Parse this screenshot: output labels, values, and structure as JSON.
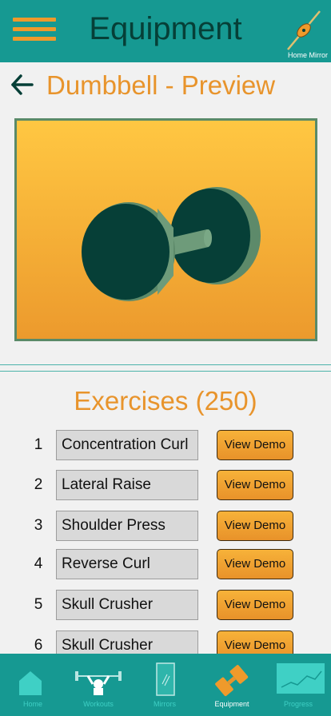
{
  "header": {
    "title": "Equipment",
    "menu_icon": "hamburger-menu-icon",
    "mirror_icon": "home-mirror-icon",
    "mirror_label": "Home Mirror"
  },
  "page": {
    "back_icon": "back-arrow-icon",
    "heading": "Dumbbell - Preview",
    "preview_image": "dumbbell-3d-render"
  },
  "exercises": {
    "heading": "Exercises (250)",
    "demo_label": "View Demo",
    "items": [
      {
        "num": "1",
        "name": "Concentration Curl"
      },
      {
        "num": "2",
        "name": "Lateral Raise"
      },
      {
        "num": "3",
        "name": "Shoulder Press"
      },
      {
        "num": "4",
        "name": "Reverse Curl"
      },
      {
        "num": "5",
        "name": "Skull Crusher"
      },
      {
        "num": "6",
        "name": "Skull Crusher"
      }
    ]
  },
  "tabbar": {
    "tabs": [
      {
        "label": "Home",
        "icon": "home-icon"
      },
      {
        "label": "Workouts",
        "icon": "workouts-icon"
      },
      {
        "label": "Mirrors",
        "icon": "mirror-icon"
      },
      {
        "label": "Equipment",
        "icon": "dumbbell-icon"
      },
      {
        "label": "Progress",
        "icon": "progress-chart-icon"
      }
    ],
    "active": "Equipment"
  },
  "colors": {
    "teal": "#169992",
    "orange": "#e8942c",
    "dark_green": "#063f37",
    "background": "#f1f1f1"
  }
}
